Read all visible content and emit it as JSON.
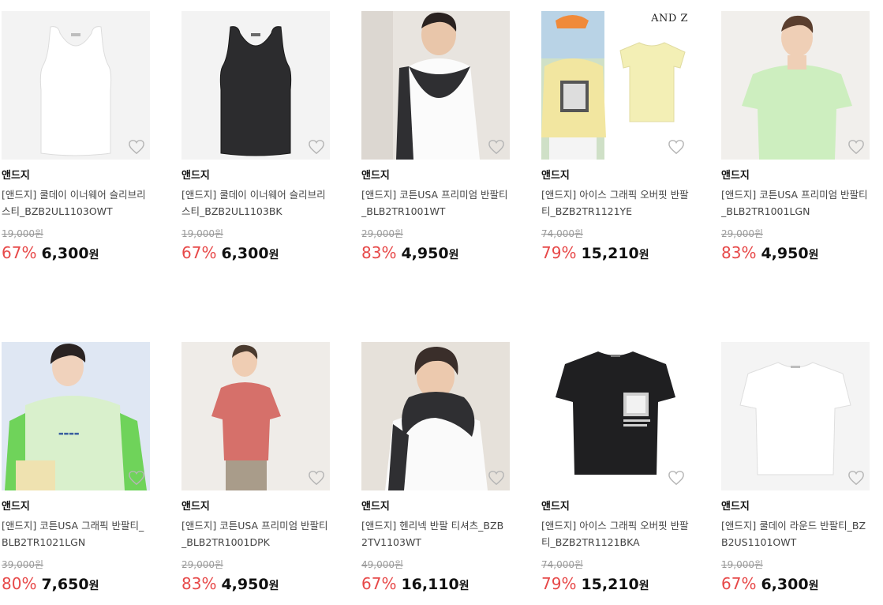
{
  "products": [
    {
      "brand": "앤드지",
      "name": "[앤드지] 쿨데이 이너웨어 슬리브리스티_BZB2UL1103OWT",
      "original_price": "19,000원",
      "discount": "67%",
      "price": "6,300",
      "currency": "원",
      "image": "white-sleeveless-top"
    },
    {
      "brand": "앤드지",
      "name": "[앤드지] 쿨데이 이너웨어 슬리브리스티_BZB2UL1103BK",
      "original_price": "19,000원",
      "discount": "67%",
      "price": "6,300",
      "currency": "원",
      "image": "black-sleeveless-top"
    },
    {
      "brand": "앤드지",
      "name": "[앤드지] 코튼USA 프리미엄 반팔티_BLB2TR1001WT",
      "original_price": "29,000원",
      "discount": "83%",
      "price": "4,950",
      "currency": "원",
      "image": "model-white-tee-dark-sweater"
    },
    {
      "brand": "앤드지",
      "name": "[앤드지] 아이스 그래픽 오버핏 반팔티_BZB2TR1121YE",
      "original_price": "74,000원",
      "discount": "79%",
      "price": "15,210",
      "currency": "원",
      "image": "yellow-graphic-tee",
      "image_text": "AND Z"
    },
    {
      "brand": "앤드지",
      "name": "[앤드지] 코튼USA 프리미엄 반팔티_BLB2TR1001LGN",
      "original_price": "29,000원",
      "discount": "83%",
      "price": "4,950",
      "currency": "원",
      "image": "model-light-green-tee"
    },
    {
      "brand": "앤드지",
      "name": "[앤드지] 코튼USA 그래픽 반팔티_BLB2TR1021LGN",
      "original_price": "39,000원",
      "discount": "80%",
      "price": "7,650",
      "currency": "원",
      "image": "model-mint-graphic-tee"
    },
    {
      "brand": "앤드지",
      "name": "[앤드지] 코튼USA 프리미엄 반팔티_BLB2TR1001DPK",
      "original_price": "29,000원",
      "discount": "83%",
      "price": "4,950",
      "currency": "원",
      "image": "model-pink-tee"
    },
    {
      "brand": "앤드지",
      "name": "[앤드지] 헨리넥 반팔 티셔츠_BZB2TV1103WT",
      "original_price": "49,000원",
      "discount": "67%",
      "price": "16,110",
      "currency": "원",
      "image": "model-henley-tee"
    },
    {
      "brand": "앤드지",
      "name": "[앤드지] 아이스 그래픽 오버핏 반팔티_BZB2TR1121BKA",
      "original_price": "74,000원",
      "discount": "79%",
      "price": "15,210",
      "currency": "원",
      "image": "black-graphic-tee"
    },
    {
      "brand": "앤드지",
      "name": "[앤드지] 쿨데이 라운드 반팔티_BZB2US1101OWT",
      "original_price": "19,000원",
      "discount": "67%",
      "price": "6,300",
      "currency": "원",
      "image": "white-round-tee"
    }
  ],
  "colors": {
    "discount": "#e74848",
    "price": "#111111",
    "original_price": "#999999",
    "brand": "#111111"
  },
  "icons": {
    "wishlist": "heart-outline-icon"
  }
}
